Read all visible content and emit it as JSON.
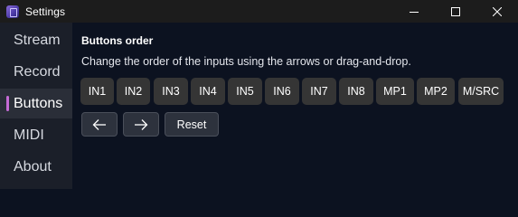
{
  "window": {
    "title": "Settings",
    "app_icon": "app-icon"
  },
  "controls": {
    "minimize_icon": "minimize-icon",
    "maximize_icon": "maximize-icon",
    "close_icon": "close-icon"
  },
  "sidebar": {
    "items": [
      {
        "label": "Stream",
        "active": false
      },
      {
        "label": "Record",
        "active": false
      },
      {
        "label": "Buttons",
        "active": true
      },
      {
        "label": "MIDI",
        "active": false
      },
      {
        "label": "About",
        "active": false
      }
    ],
    "accent_color": "#c66bd6"
  },
  "main": {
    "heading": "Buttons order",
    "description": "Change the order of the inputs using the arrows or drag-and-drop.",
    "inputs": [
      "IN1",
      "IN2",
      "IN3",
      "IN4",
      "IN5",
      "IN6",
      "IN7",
      "IN8",
      "MP1",
      "MP2",
      "M/SRC"
    ],
    "move_left_icon": "arrow-left-icon",
    "move_right_icon": "arrow-right-icon",
    "reset_label": "Reset"
  }
}
